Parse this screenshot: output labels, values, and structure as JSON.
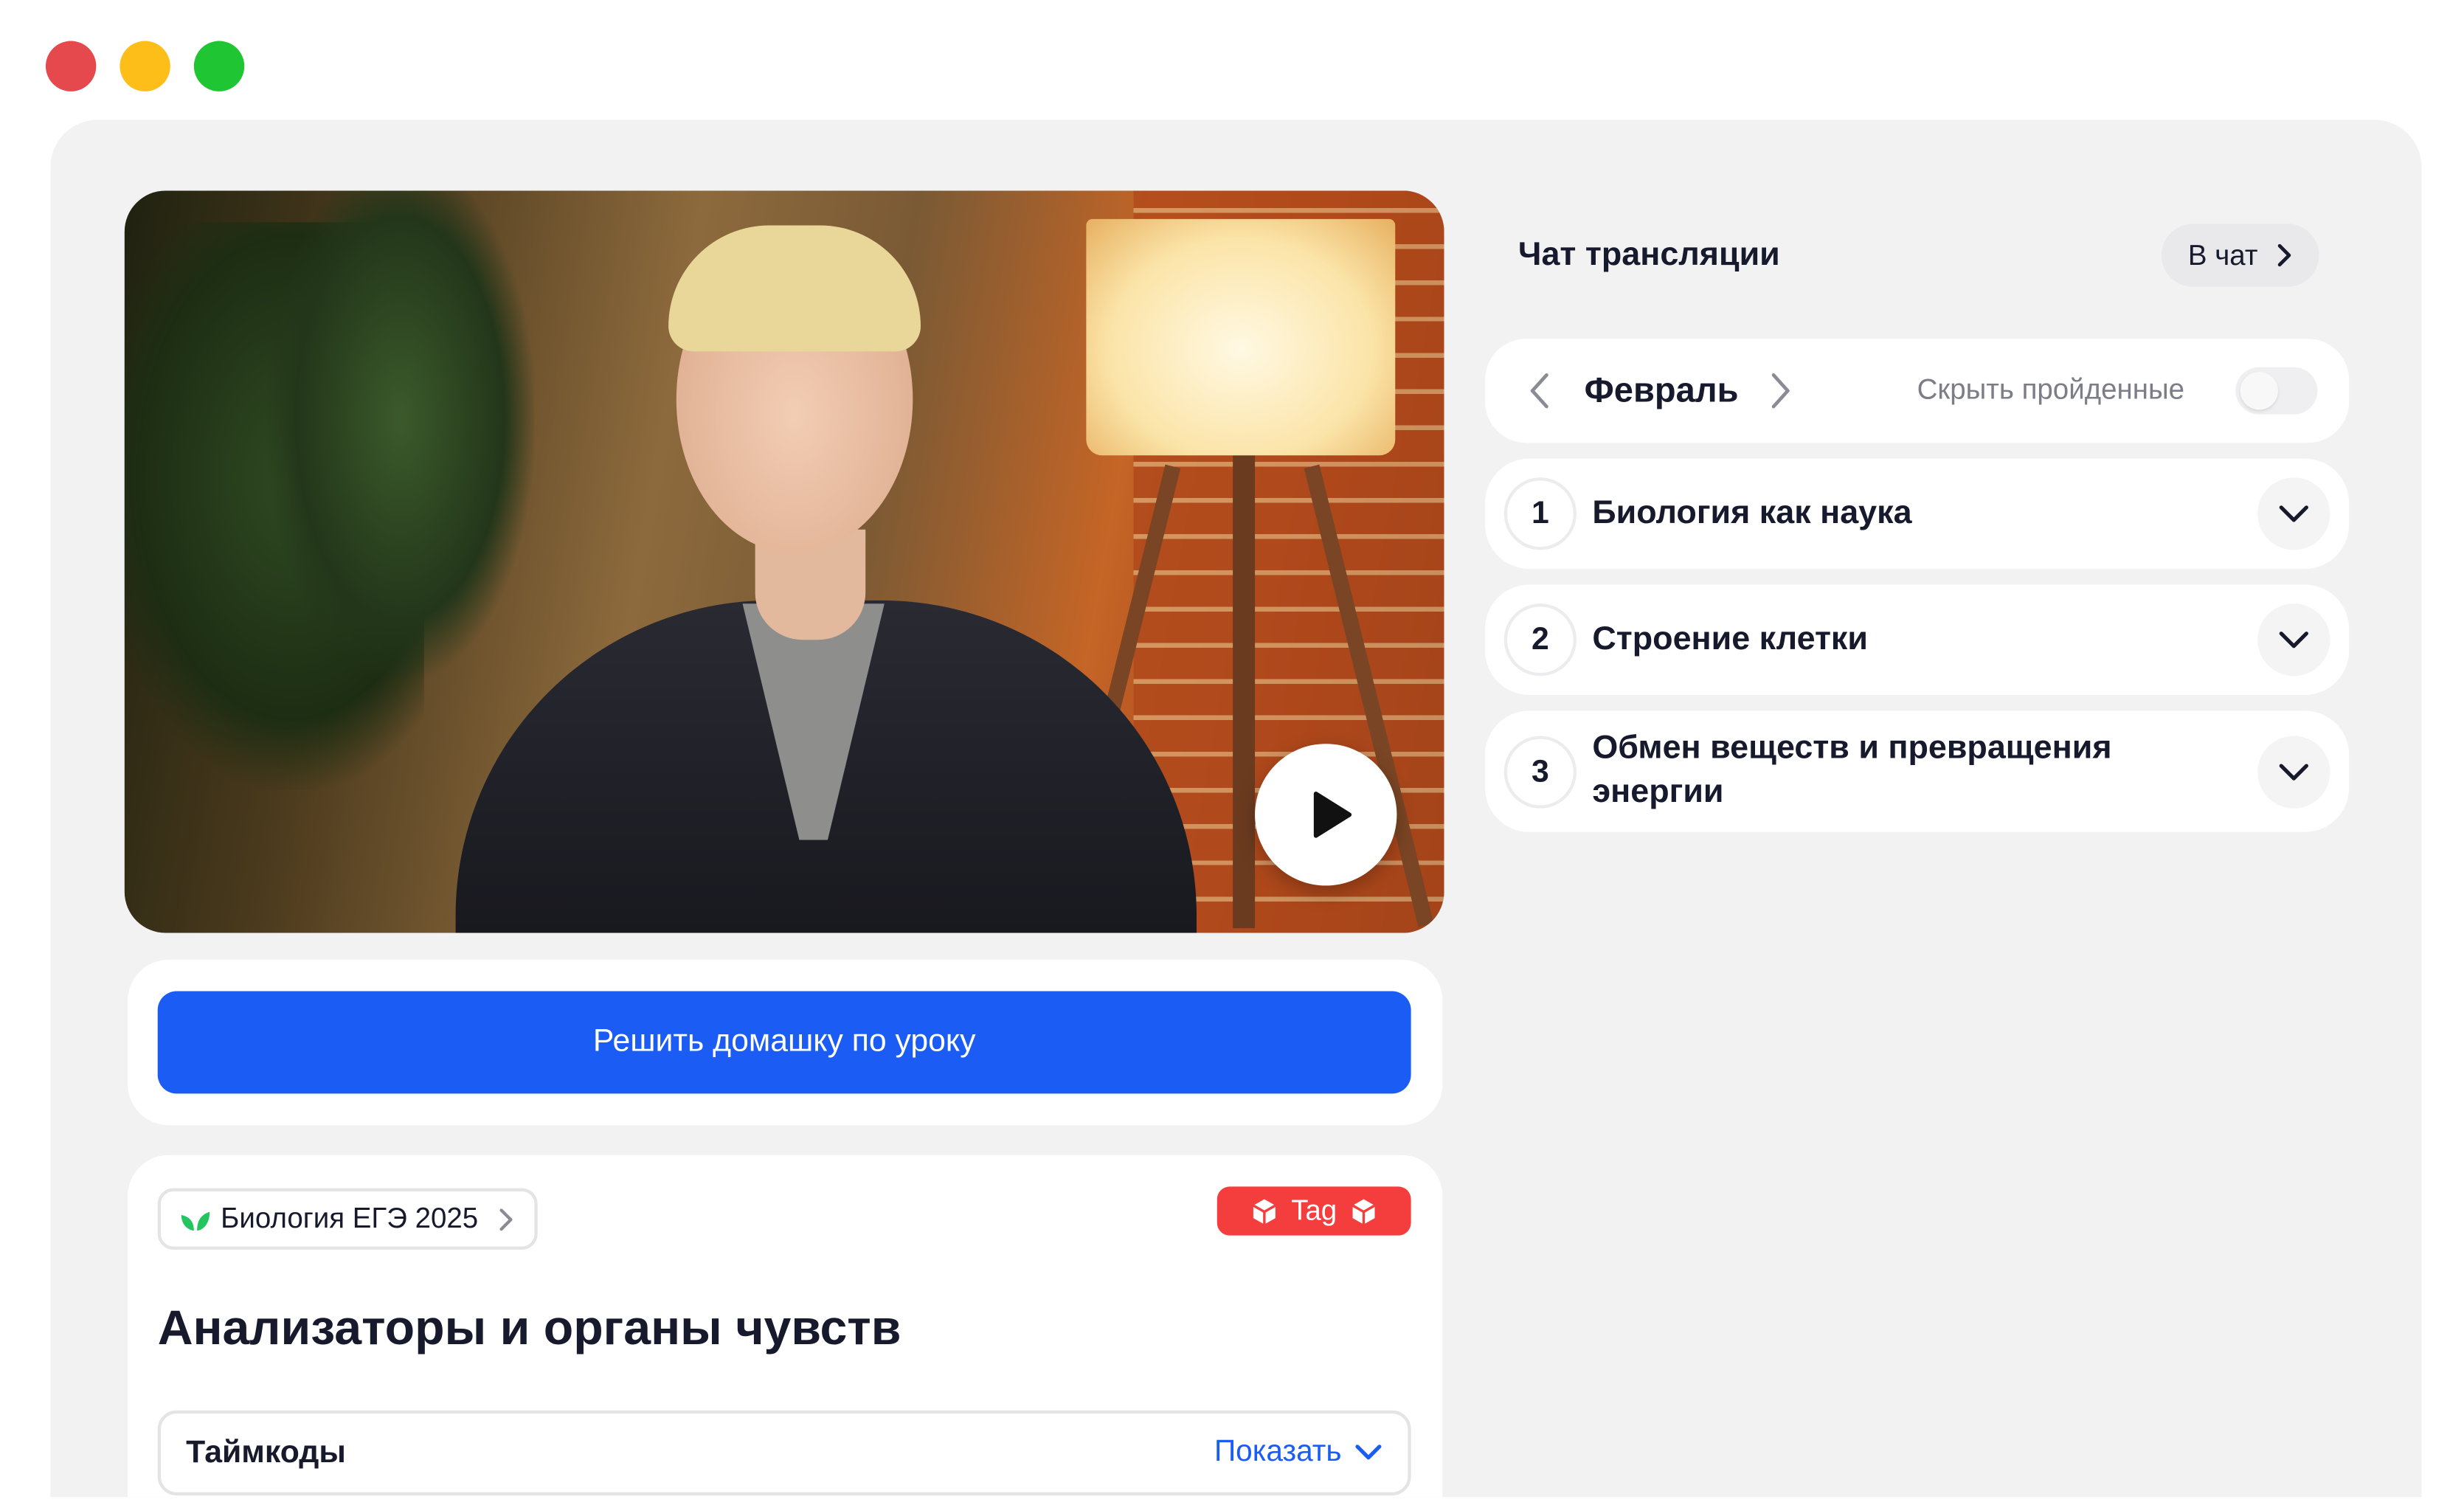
{
  "window": {
    "controls": [
      "close",
      "minimize",
      "maximize"
    ]
  },
  "video": {
    "play_icon": "play-icon"
  },
  "homework": {
    "button_label": "Решить домашку по уроку"
  },
  "lesson": {
    "course_label": "Биология ЕГЭ 2025",
    "tag_label": "Tag",
    "title": "Анализаторы и органы чувств",
    "timecodes_label": "Таймкоды",
    "timecodes_action": "Показать"
  },
  "chat": {
    "title": "Чат трансляции",
    "button_label": "В чат"
  },
  "schedule": {
    "month": "Февраль",
    "hide_label": "Скрыть пройденные",
    "hide_enabled": false,
    "topics": [
      {
        "number": "1",
        "title": "Биология как наука"
      },
      {
        "number": "2",
        "title": "Строение клетки"
      },
      {
        "number": "3",
        "title": "Обмен веществ и превращения энергии"
      }
    ]
  },
  "colors": {
    "accent": "#1a5cf4",
    "tag": "#f43d3d",
    "panel": "#f2f2f3",
    "leaf": "#22c55e"
  }
}
